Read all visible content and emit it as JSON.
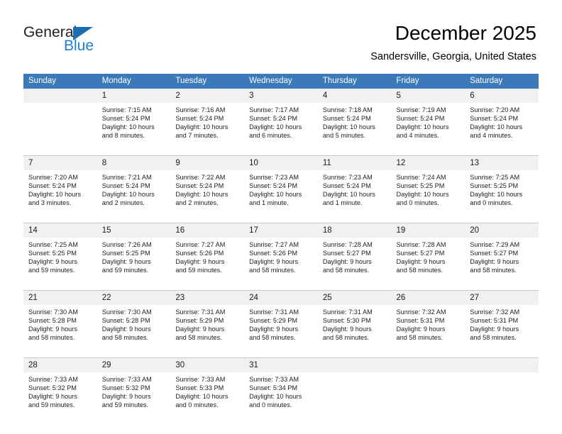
{
  "brand": {
    "name_part1": "General",
    "name_part2": "Blue"
  },
  "header": {
    "title": "December 2025",
    "location": "Sandersville, Georgia, United States"
  },
  "colors": {
    "header_blue": "#3b79b8",
    "brand_blue": "#1b7fd4",
    "logo_triangle": "#1b6cb3",
    "daynum_bg": "#f1f1f1",
    "grid_line": "#c9c9c9"
  },
  "weekday_headers": [
    "Sunday",
    "Monday",
    "Tuesday",
    "Wednesday",
    "Thursday",
    "Friday",
    "Saturday"
  ],
  "weeks": [
    {
      "days": [
        {
          "number": "",
          "lines": []
        },
        {
          "number": "1",
          "lines": [
            "Sunrise: 7:15 AM",
            "Sunset: 5:24 PM",
            "Daylight: 10 hours",
            "and 8 minutes."
          ]
        },
        {
          "number": "2",
          "lines": [
            "Sunrise: 7:16 AM",
            "Sunset: 5:24 PM",
            "Daylight: 10 hours",
            "and 7 minutes."
          ]
        },
        {
          "number": "3",
          "lines": [
            "Sunrise: 7:17 AM",
            "Sunset: 5:24 PM",
            "Daylight: 10 hours",
            "and 6 minutes."
          ]
        },
        {
          "number": "4",
          "lines": [
            "Sunrise: 7:18 AM",
            "Sunset: 5:24 PM",
            "Daylight: 10 hours",
            "and 5 minutes."
          ]
        },
        {
          "number": "5",
          "lines": [
            "Sunrise: 7:19 AM",
            "Sunset: 5:24 PM",
            "Daylight: 10 hours",
            "and 4 minutes."
          ]
        },
        {
          "number": "6",
          "lines": [
            "Sunrise: 7:20 AM",
            "Sunset: 5:24 PM",
            "Daylight: 10 hours",
            "and 4 minutes."
          ]
        }
      ]
    },
    {
      "days": [
        {
          "number": "7",
          "lines": [
            "Sunrise: 7:20 AM",
            "Sunset: 5:24 PM",
            "Daylight: 10 hours",
            "and 3 minutes."
          ]
        },
        {
          "number": "8",
          "lines": [
            "Sunrise: 7:21 AM",
            "Sunset: 5:24 PM",
            "Daylight: 10 hours",
            "and 2 minutes."
          ]
        },
        {
          "number": "9",
          "lines": [
            "Sunrise: 7:22 AM",
            "Sunset: 5:24 PM",
            "Daylight: 10 hours",
            "and 2 minutes."
          ]
        },
        {
          "number": "10",
          "lines": [
            "Sunrise: 7:23 AM",
            "Sunset: 5:24 PM",
            "Daylight: 10 hours",
            "and 1 minute."
          ]
        },
        {
          "number": "11",
          "lines": [
            "Sunrise: 7:23 AM",
            "Sunset: 5:24 PM",
            "Daylight: 10 hours",
            "and 1 minute."
          ]
        },
        {
          "number": "12",
          "lines": [
            "Sunrise: 7:24 AM",
            "Sunset: 5:25 PM",
            "Daylight: 10 hours",
            "and 0 minutes."
          ]
        },
        {
          "number": "13",
          "lines": [
            "Sunrise: 7:25 AM",
            "Sunset: 5:25 PM",
            "Daylight: 10 hours",
            "and 0 minutes."
          ]
        }
      ]
    },
    {
      "days": [
        {
          "number": "14",
          "lines": [
            "Sunrise: 7:25 AM",
            "Sunset: 5:25 PM",
            "Daylight: 9 hours",
            "and 59 minutes."
          ]
        },
        {
          "number": "15",
          "lines": [
            "Sunrise: 7:26 AM",
            "Sunset: 5:25 PM",
            "Daylight: 9 hours",
            "and 59 minutes."
          ]
        },
        {
          "number": "16",
          "lines": [
            "Sunrise: 7:27 AM",
            "Sunset: 5:26 PM",
            "Daylight: 9 hours",
            "and 59 minutes."
          ]
        },
        {
          "number": "17",
          "lines": [
            "Sunrise: 7:27 AM",
            "Sunset: 5:26 PM",
            "Daylight: 9 hours",
            "and 58 minutes."
          ]
        },
        {
          "number": "18",
          "lines": [
            "Sunrise: 7:28 AM",
            "Sunset: 5:27 PM",
            "Daylight: 9 hours",
            "and 58 minutes."
          ]
        },
        {
          "number": "19",
          "lines": [
            "Sunrise: 7:28 AM",
            "Sunset: 5:27 PM",
            "Daylight: 9 hours",
            "and 58 minutes."
          ]
        },
        {
          "number": "20",
          "lines": [
            "Sunrise: 7:29 AM",
            "Sunset: 5:27 PM",
            "Daylight: 9 hours",
            "and 58 minutes."
          ]
        }
      ]
    },
    {
      "days": [
        {
          "number": "21",
          "lines": [
            "Sunrise: 7:30 AM",
            "Sunset: 5:28 PM",
            "Daylight: 9 hours",
            "and 58 minutes."
          ]
        },
        {
          "number": "22",
          "lines": [
            "Sunrise: 7:30 AM",
            "Sunset: 5:28 PM",
            "Daylight: 9 hours",
            "and 58 minutes."
          ]
        },
        {
          "number": "23",
          "lines": [
            "Sunrise: 7:31 AM",
            "Sunset: 5:29 PM",
            "Daylight: 9 hours",
            "and 58 minutes."
          ]
        },
        {
          "number": "24",
          "lines": [
            "Sunrise: 7:31 AM",
            "Sunset: 5:29 PM",
            "Daylight: 9 hours",
            "and 58 minutes."
          ]
        },
        {
          "number": "25",
          "lines": [
            "Sunrise: 7:31 AM",
            "Sunset: 5:30 PM",
            "Daylight: 9 hours",
            "and 58 minutes."
          ]
        },
        {
          "number": "26",
          "lines": [
            "Sunrise: 7:32 AM",
            "Sunset: 5:31 PM",
            "Daylight: 9 hours",
            "and 58 minutes."
          ]
        },
        {
          "number": "27",
          "lines": [
            "Sunrise: 7:32 AM",
            "Sunset: 5:31 PM",
            "Daylight: 9 hours",
            "and 58 minutes."
          ]
        }
      ]
    },
    {
      "days": [
        {
          "number": "28",
          "lines": [
            "Sunrise: 7:33 AM",
            "Sunset: 5:32 PM",
            "Daylight: 9 hours",
            "and 59 minutes."
          ]
        },
        {
          "number": "29",
          "lines": [
            "Sunrise: 7:33 AM",
            "Sunset: 5:32 PM",
            "Daylight: 9 hours",
            "and 59 minutes."
          ]
        },
        {
          "number": "30",
          "lines": [
            "Sunrise: 7:33 AM",
            "Sunset: 5:33 PM",
            "Daylight: 10 hours",
            "and 0 minutes."
          ]
        },
        {
          "number": "31",
          "lines": [
            "Sunrise: 7:33 AM",
            "Sunset: 5:34 PM",
            "Daylight: 10 hours",
            "and 0 minutes."
          ]
        },
        {
          "number": "",
          "lines": []
        },
        {
          "number": "",
          "lines": []
        },
        {
          "number": "",
          "lines": []
        }
      ]
    }
  ]
}
